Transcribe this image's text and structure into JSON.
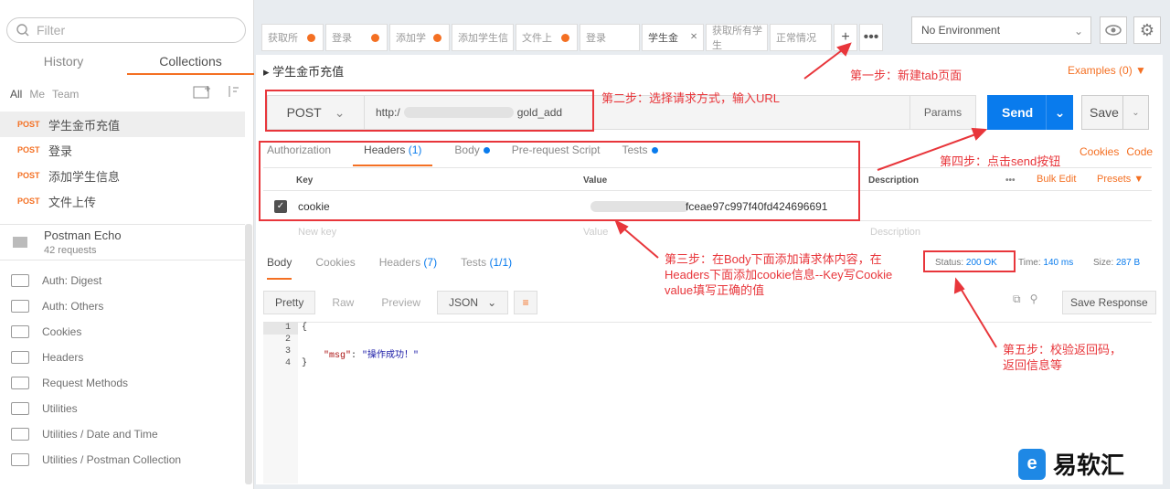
{
  "sidebar": {
    "filter_placeholder": "Filter",
    "tabs": [
      "History",
      "Collections"
    ],
    "subtabs": [
      "All",
      "Me",
      "Team"
    ],
    "requests": [
      {
        "method": "POST",
        "name": "学生金币充值"
      },
      {
        "method": "POST",
        "name": "登录"
      },
      {
        "method": "POST",
        "name": "添加学生信息"
      },
      {
        "method": "POST",
        "name": "文件上传"
      }
    ],
    "echo": {
      "title": "Postman Echo",
      "sub": "42 requests"
    },
    "folders": [
      "Auth: Digest",
      "Auth: Others",
      "Cookies",
      "Headers",
      "Request Methods",
      "Utilities",
      "Utilities / Date and Time",
      "Utilities / Postman Collection"
    ]
  },
  "tabs": [
    "获取所",
    "登录",
    "添加学",
    "添加学生信",
    "文件上",
    "登录",
    "学生金",
    "获取所有学生",
    "正常情况"
  ],
  "env": {
    "label": "No Environment"
  },
  "request": {
    "name": "学生金币充值",
    "examples": "Examples (0) ▼",
    "method": "POST",
    "url_start": "http:/",
    "url_end": "gold_add",
    "params": "Params",
    "send": "Send",
    "save": "Save"
  },
  "req_tabs": {
    "auth": "Authorization",
    "headers": "Headers",
    "headers_count": "(1)",
    "body": "Body",
    "pre": "Pre-request Script",
    "tests": "Tests"
  },
  "links": {
    "cookies": "Cookies",
    "code": "Code"
  },
  "table": {
    "key": "Key",
    "value": "Value",
    "description": "Description",
    "more": "•••",
    "bulk": "Bulk Edit",
    "presets": "Presets ▼",
    "row_key": "cookie",
    "row_value": "fceae97c997f40fd424696691",
    "new_key": "New key",
    "new_value": "Value",
    "new_desc": "Description"
  },
  "response": {
    "tabs": {
      "body": "Body",
      "cookies": "Cookies",
      "headers": "Headers",
      "headers_count": "(7)",
      "tests": "Tests",
      "tests_count": "(1/1)"
    },
    "status_label": "Status:",
    "status": "200 OK",
    "time_label": "Time:",
    "time": "140 ms",
    "size_label": "Size:",
    "size": "287 B",
    "pretty": "Pretty",
    "raw": "Raw",
    "preview": "Preview",
    "format": "JSON",
    "save_response": "Save Response",
    "lines": [
      "1",
      "2",
      "3",
      "4"
    ],
    "code_open": "{",
    "msg_key": "\"msg\"",
    "msg_value": "\"操作成功！\"",
    "code_close": "}"
  },
  "annotations": {
    "step1": "第一步：新建tab页面",
    "step2": "第二步：选择请求方式，输入URL",
    "step3a": "第三步：在Body下面添加请求体内容，在",
    "step3b": "Headers下面添加cookie信息--Key写Cookie",
    "step3c": "value填写正确的值",
    "step4": "第四步：点击send按钮",
    "step5a": "第五步：校验返回码，",
    "step5b": "返回信息等"
  },
  "watermark": {
    "text": "易软汇"
  }
}
